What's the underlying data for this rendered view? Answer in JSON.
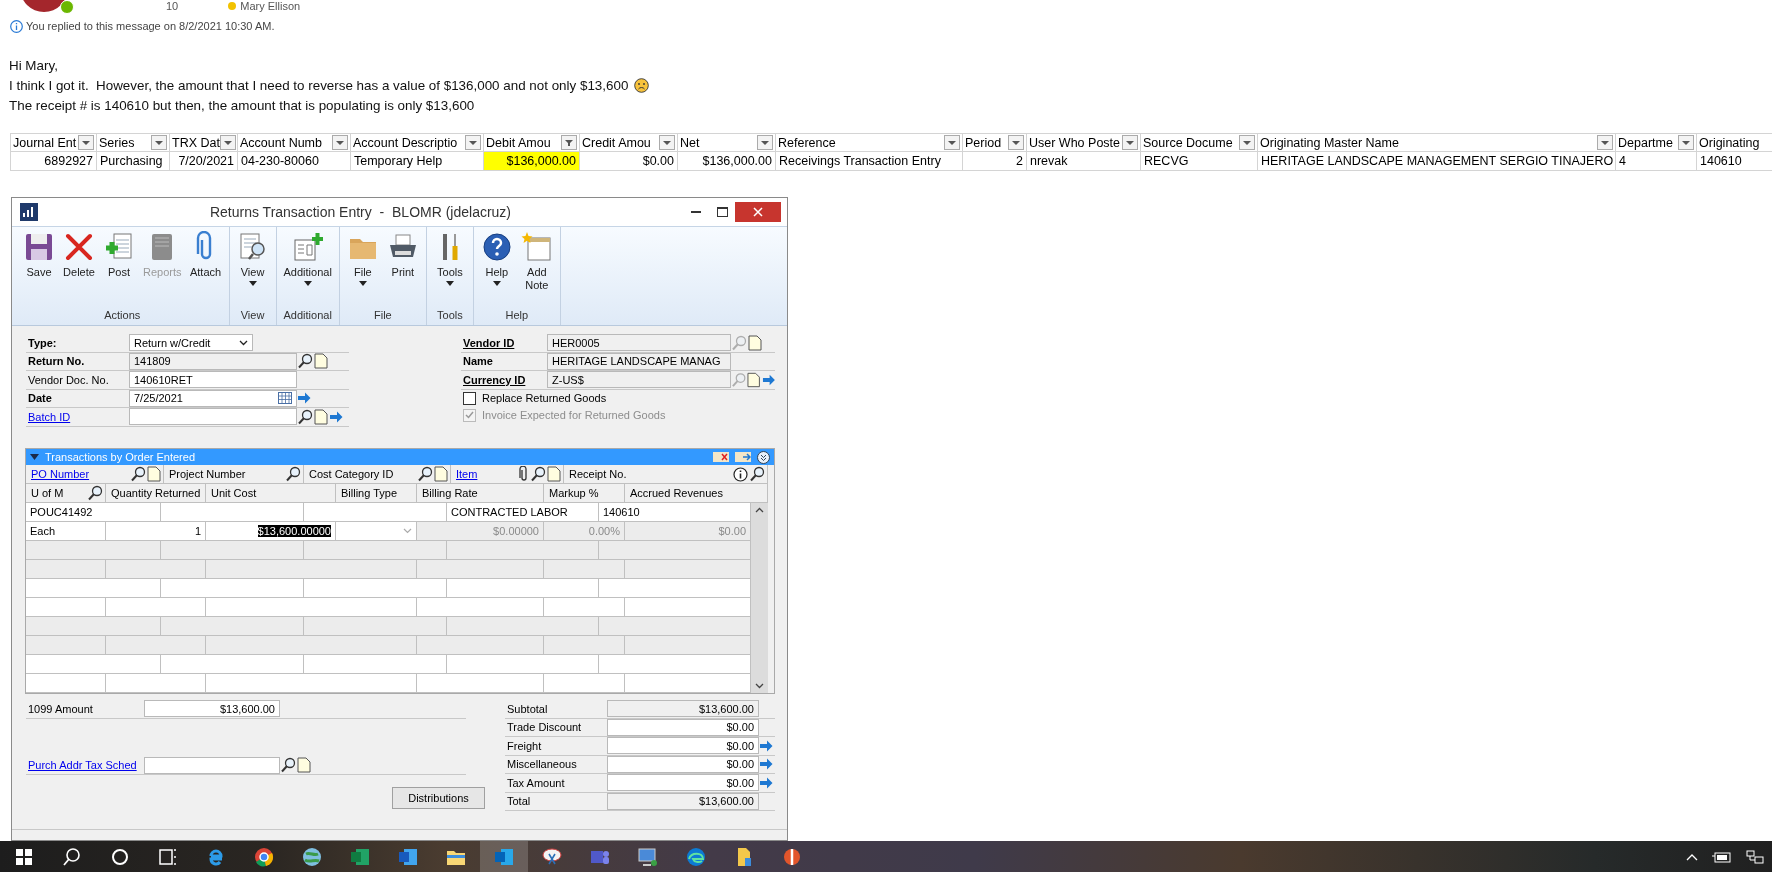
{
  "email": {
    "sender": {
      "count": "10",
      "name": "Mary Ellison"
    },
    "notice": "You replied to this message on 8/2/2021 10:30 AM.",
    "body": [
      {
        "text": "Hi Mary,",
        "frown": false
      },
      {
        "text": "I think I got it.  However, the amount that I need to reverse has a value of $136,000 and not only $13,600",
        "frown": true
      },
      {
        "text": "The receipt # is 140610 but then, the amount that is populating is only $13,600",
        "frown": false
      }
    ]
  },
  "spreadsheet": {
    "columns": [
      {
        "label": "Journal Ent",
        "filtered": false
      },
      {
        "label": "Series",
        "filtered": false
      },
      {
        "label": "TRX Dat",
        "filtered": false
      },
      {
        "label": "Account Numb",
        "filtered": false
      },
      {
        "label": "Account Descriptio",
        "filtered": false
      },
      {
        "label": "Debit Amou",
        "filtered": true
      },
      {
        "label": "Credit Amou",
        "filtered": false
      },
      {
        "label": "Net",
        "filtered": false
      },
      {
        "label": "Reference",
        "filtered": false
      },
      {
        "label": "Period",
        "filtered": false
      },
      {
        "label": "User Who Poste",
        "filtered": false
      },
      {
        "label": "Source Docume",
        "filtered": false
      },
      {
        "label": "Originating Master Name",
        "filtered": false
      },
      {
        "label": "Departme",
        "filtered": false
      },
      {
        "label": "Originating"
      }
    ],
    "rows": [
      {
        "cells": [
          {
            "text": "6892927",
            "highlighted": false
          },
          {
            "text": "Purchasing",
            "highlighted": false
          },
          {
            "text": "7/20/2021",
            "highlighted": false
          },
          {
            "text": "04-230-80060",
            "highlighted": false
          },
          {
            "text": "Temporary Help",
            "highlighted": false
          },
          {
            "text": "$136,000.00",
            "highlighted": true
          },
          {
            "text": "$0.00",
            "highlighted": false
          },
          {
            "text": "$136,000.00",
            "highlighted": false
          },
          {
            "text": "Receivings Transaction Entry",
            "highlighted": false
          },
          {
            "text": "2",
            "highlighted": false
          },
          {
            "text": "nrevak",
            "highlighted": false
          },
          {
            "text": "RECVG",
            "highlighted": false
          },
          {
            "text": "HERITAGE LANDSCAPE MANAGEMENT SERGIO TINAJERO",
            "highlighted": false
          },
          {
            "text": "4",
            "highlighted": false
          },
          {
            "text": "140610",
            "highlighted": false
          }
        ]
      }
    ]
  },
  "dialog": {
    "title": "Returns Transaction Entry  -  BLOMR (jdelacruz)",
    "toolbar": [
      {
        "label": "Actions",
        "buttons": [
          {
            "kind": "save",
            "label": "Save",
            "disabled": false,
            "dropdown": false
          },
          {
            "kind": "delete",
            "label": "Delete",
            "disabled": false,
            "dropdown": false
          },
          {
            "kind": "post",
            "label": "Post",
            "disabled": false,
            "dropdown": false
          },
          {
            "kind": "reports",
            "label": "Reports",
            "disabled": true,
            "dropdown": false
          },
          {
            "kind": "attach",
            "label": "Attach",
            "disabled": false,
            "dropdown": false
          }
        ]
      },
      {
        "label": "View",
        "buttons": [
          {
            "kind": "view",
            "label": "View",
            "disabled": false,
            "dropdown": true
          }
        ]
      },
      {
        "label": "Additional",
        "buttons": [
          {
            "kind": "additional",
            "label": "Additional",
            "disabled": false,
            "dropdown": true
          }
        ]
      },
      {
        "label": "File",
        "buttons": [
          {
            "kind": "file",
            "label": "File",
            "disabled": false,
            "dropdown": true
          },
          {
            "kind": "print",
            "label": "Print",
            "disabled": false,
            "dropdown": false
          }
        ]
      },
      {
        "label": "Tools",
        "buttons": [
          {
            "kind": "tools",
            "label": "Tools",
            "disabled": false,
            "dropdown": true
          }
        ]
      },
      {
        "label": "Help",
        "buttons": [
          {
            "kind": "help",
            "label": "Help",
            "disabled": false,
            "dropdown": true
          },
          {
            "kind": "note",
            "label": "Add Note",
            "disabled": false,
            "dropdown": false
          }
        ]
      }
    ],
    "document_fields": [
      {
        "label": "Type:",
        "bold": true,
        "link": false,
        "kind": "select",
        "value": "Return w/Credit",
        "readonly": false
      },
      {
        "label": "Return No.",
        "bold": true,
        "link": false,
        "kind": "text",
        "value": "141809",
        "readonly": true,
        "lookup": true,
        "note": true
      },
      {
        "label": "Vendor Doc. No.",
        "bold": false,
        "link": false,
        "kind": "text",
        "value": "140610RET",
        "readonly": false
      },
      {
        "label": "Date",
        "bold": true,
        "link": false,
        "kind": "date",
        "value": "7/25/2021",
        "readonly": false,
        "arrow": true
      },
      {
        "label": "Batch ID",
        "bold": false,
        "link": true,
        "kind": "text",
        "readonly": false,
        "lookup": true,
        "note": true,
        "arrow": true
      }
    ],
    "vendor_fields": [
      {
        "label": "Vendor ID",
        "bold": true,
        "link": true,
        "value": "HER0005",
        "readonly": true,
        "lookup": true,
        "note": true
      },
      {
        "label": "Name",
        "bold": true,
        "link": false,
        "value": "HERITAGE LANDSCAPE MANAG",
        "readonly": true
      },
      {
        "label": "Currency ID",
        "bold": true,
        "link": true,
        "value": "Z-US$",
        "readonly": true,
        "lookup": true,
        "note": true,
        "arrow": true
      }
    ],
    "checkboxes": [
      {
        "label": "Replace Returned Goods",
        "checked": false,
        "disabled": false
      },
      {
        "label": "Invoice Expected for Returned Goods",
        "checked": true,
        "disabled": true
      }
    ],
    "grid": {
      "title": "Transactions by Order Entered",
      "header_top": [
        {
          "label": "PO Number",
          "link": true,
          "lookup": true,
          "note": true
        },
        {
          "label": "Project Number",
          "link": false,
          "lookup": true
        },
        {
          "label": "Cost Category ID",
          "link": false,
          "lookup": true,
          "note": true
        },
        {
          "label": "Item",
          "link": true,
          "clip": true,
          "lookup": true,
          "note": true
        },
        {
          "label": "Receipt No.",
          "link": false,
          "info": true,
          "lookup": true
        }
      ],
      "header_bottom": [
        {
          "label": "U of M",
          "lookup": true
        },
        {
          "label": "Quantity Returned"
        },
        {
          "label": "Unit Cost"
        },
        {
          "label": "Billing Type"
        },
        {
          "label": "Billing Rate"
        },
        {
          "label": "Markup %"
        },
        {
          "label": "Accrued Revenues"
        }
      ],
      "rows": [
        {
          "po_number": "POUC41492",
          "item": "CONTRACTED LABOR",
          "receipt_no": "140610",
          "u_of_m": "Each",
          "quantity": "1",
          "unit_cost": {
            "text": "$13,600.00000",
            "selected": true
          },
          "billing_rate": {
            "text": "$0.00000",
            "disabled": true
          },
          "markup": {
            "text": "0.00%",
            "disabled": true
          },
          "accrued_revenues": {
            "text": "$0.00",
            "disabled": true
          }
        }
      ]
    },
    "amount_1099": {
      "label": "1099 Amount",
      "value": "$13,600.00"
    },
    "tax_schedule": {
      "label": "Purch Addr Tax Sched",
      "lookup": true,
      "note": true
    },
    "distributions_button": "Distributions",
    "totals": [
      {
        "label": "Subtotal",
        "value": "$13,600.00",
        "readonly": true,
        "arrow": false
      },
      {
        "label": "Trade Discount",
        "value": "$0.00",
        "readonly": false,
        "arrow": false
      },
      {
        "label": "Freight",
        "value": "$0.00",
        "readonly": false,
        "arrow": true
      },
      {
        "label": "Miscellaneous",
        "value": "$0.00",
        "readonly": false,
        "arrow": true
      },
      {
        "label": "Tax Amount",
        "value": "$0.00",
        "readonly": false,
        "arrow": true
      },
      {
        "label": "Total",
        "value": "$13,600.00",
        "readonly": true,
        "arrow": false
      }
    ]
  },
  "taskbar": [
    {
      "kind": "start",
      "selected": false
    },
    {
      "kind": "search",
      "selected": false
    },
    {
      "kind": "cortana",
      "selected": false
    },
    {
      "kind": "taskview",
      "selected": false
    },
    {
      "kind": "ie",
      "selected": false
    },
    {
      "kind": "chrome",
      "selected": false
    },
    {
      "kind": "globe",
      "selected": false
    },
    {
      "kind": "excel",
      "selected": false
    },
    {
      "kind": "word",
      "selected": false
    },
    {
      "kind": "folder",
      "selected": false
    },
    {
      "kind": "outlook",
      "selected": true
    },
    {
      "kind": "snip",
      "selected": false
    },
    {
      "kind": "teams",
      "selected": false
    },
    {
      "kind": "remote",
      "selected": false
    },
    {
      "kind": "edge",
      "selected": false
    },
    {
      "kind": "file",
      "selected": false
    },
    {
      "kind": "app",
      "selected": false
    }
  ]
}
